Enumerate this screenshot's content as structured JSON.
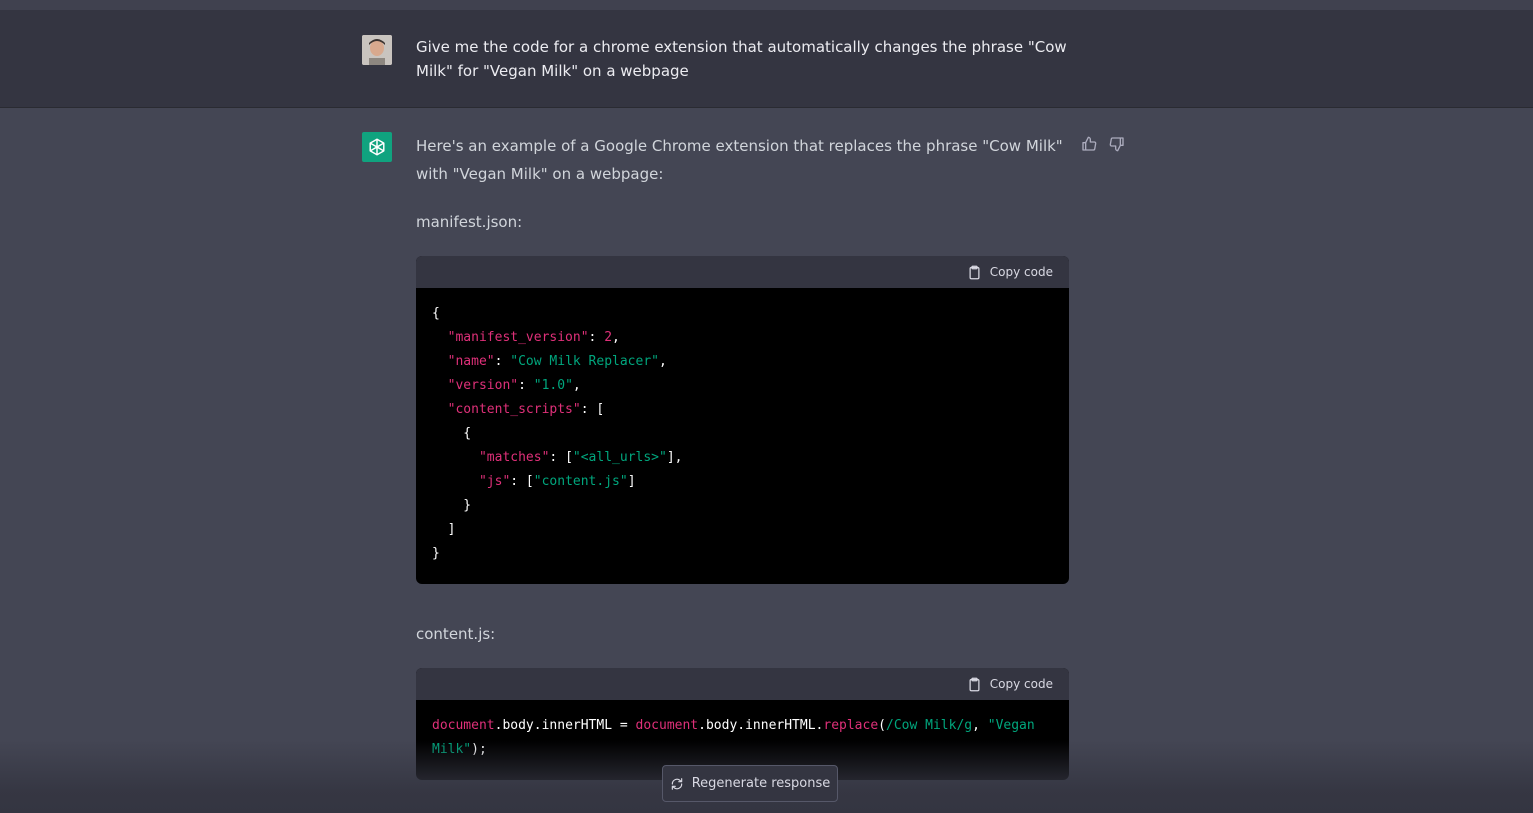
{
  "conversation": {
    "user_message": "Give me the code for a chrome extension that automatically changes the phrase \"Cow Milk\" for \"Vegan Milk\" on a webpage",
    "assistant_intro": "Here's an example of a Google Chrome extension that replaces the phrase \"Cow Milk\" with \"Vegan Milk\" on a webpage:",
    "manifest_label": "manifest.json:",
    "content_label": "content.js:",
    "copy_code_label": "Copy code"
  },
  "manifest_code": {
    "open": "{",
    "k1": "\"manifest_version\"",
    "v1": "2",
    "k2": "\"name\"",
    "v2": "\"Cow Milk Replacer\"",
    "k3": "\"version\"",
    "v3": "\"1.0\"",
    "k4": "\"content_scripts\"",
    "k5": "\"matches\"",
    "v5": "\"<all_urls>\"",
    "k6": "\"js\"",
    "v6": "\"content.js\"",
    "close": "}"
  },
  "content_code": {
    "t1": "document",
    "t2": ".body.innerHTML = ",
    "t3": "document",
    "t4": ".body.innerHTML.",
    "t5": "replace",
    "t6": "(",
    "t7": "/Cow Milk/g",
    "t8": ", ",
    "t9": "\"Vegan",
    "t10": "Milk\"",
    "t11": ");"
  },
  "footer": {
    "regenerate_label": "Regenerate response"
  },
  "colors": {
    "background": "#444654",
    "user_row": "#343541",
    "assistant_accent": "#10a37f",
    "code_keyword": "#df3079",
    "code_string": "#00a67d"
  }
}
